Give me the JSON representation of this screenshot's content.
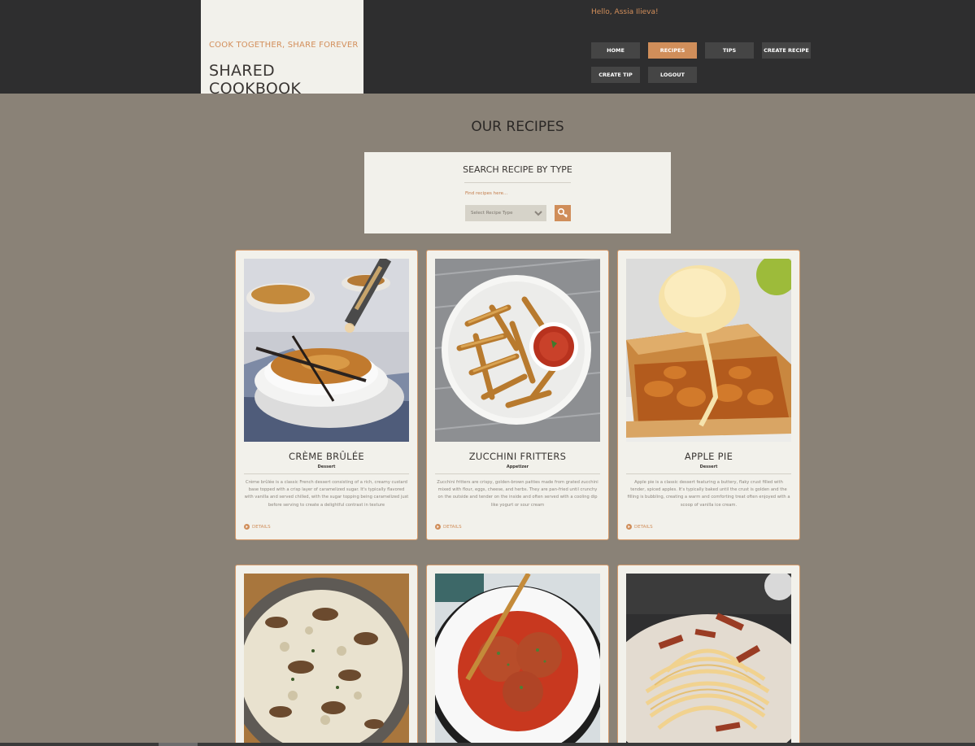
{
  "header": {
    "tagline": "COOK TOGETHER, SHARE FOREVER",
    "title": "SHARED COOKBOOK",
    "greeting": "Hello, Assia Ilieva!",
    "nav": [
      {
        "label": "HOME"
      },
      {
        "label": "RECIPES"
      },
      {
        "label": "TIPS"
      },
      {
        "label": "CREATE RECIPE"
      },
      {
        "label": "CREATE TIP"
      },
      {
        "label": "LOGOUT"
      }
    ],
    "active_nav": "RECIPES"
  },
  "main": {
    "title": "OUR RECIPES"
  },
  "search": {
    "title": "SEARCH RECIPE BY TYPE",
    "hint": "Find recipes here...",
    "select_value": "Select Recipe Type",
    "button_icon": "key-search-icon"
  },
  "recipes": [
    {
      "name": "CRÈME BRÛLÉE",
      "type": "Dessert",
      "description": "Crème brûlée is a classic French dessert consisting of a rich, creamy custard base topped with a crisp layer of caramelized sugar. It's typically flavored with vanilla and served chilled, with the sugar topping being caramelized just before serving to create a delightful contrast in texture",
      "details": "DETAILS"
    },
    {
      "name": "ZUCCHINI FRITTERS",
      "type": "Appetizer",
      "description": "Zucchini fritters are crispy, golden-brown patties made from grated zucchini mixed with flour, eggs, cheese, and herbs. They are pan-fried until crunchy on the outside and tender on the inside and often served with a cooling dip like yogurt or sour cream",
      "details": "DETAILS"
    },
    {
      "name": "APPLE PIE",
      "type": "Dessert",
      "description": "Apple pie is a classic dessert featuring a buttery, flaky crust filled with tender, spiced apples. It's typically baked until the crust is golden and the filling is bubbling, creating a warm and comforting treat often enjoyed with a scoop of vanilla ice cream.",
      "details": "DETAILS"
    }
  ],
  "colors": {
    "accent": "#d08e5a",
    "header_bg": "#2e2e2f",
    "page_bg": "#8a8277",
    "card_bg": "#f2f1eb"
  }
}
